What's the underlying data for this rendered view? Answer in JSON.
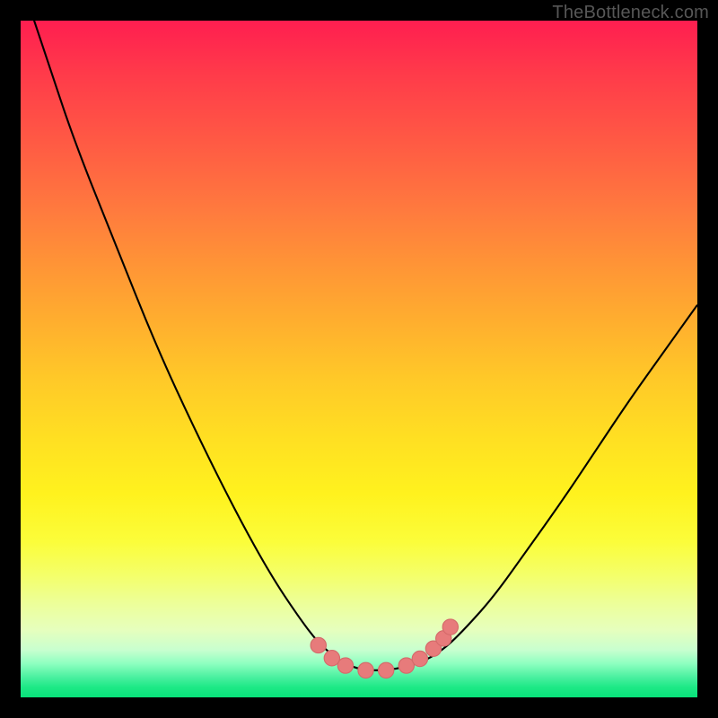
{
  "watermark": "TheBottleneck.com",
  "colors": {
    "frame": "#000000",
    "curve_stroke": "#000000",
    "marker_fill": "#e77b7b",
    "marker_stroke": "#d46a6a"
  },
  "chart_data": {
    "type": "line",
    "title": "",
    "xlabel": "",
    "ylabel": "",
    "xlim": [
      0,
      100
    ],
    "ylim": [
      0,
      100
    ],
    "grid": false,
    "legend": false,
    "note": "Axes have no numeric tick labels in the image; x/y are normalized 0–100 estimated from pixel positions. y is percent-from-top (0 = top edge, 100 = bottom edge).",
    "series": [
      {
        "name": "curve",
        "x": [
          0,
          4,
          8,
          14,
          20,
          26,
          32,
          37,
          41,
          44,
          47,
          49,
          51,
          54,
          57,
          60,
          63,
          66,
          70,
          75,
          80,
          85,
          90,
          95,
          100
        ],
        "y": [
          -6,
          6,
          18,
          33,
          48,
          61,
          73,
          82,
          88,
          92,
          94.5,
          95.5,
          96,
          96,
          95.5,
          94.5,
          92.5,
          89.5,
          85,
          78,
          71,
          63.5,
          56,
          49,
          42
        ]
      }
    ],
    "markers": {
      "name": "highlight-points",
      "x": [
        44,
        46,
        48,
        51,
        54,
        57,
        59,
        61,
        62.5,
        63.5
      ],
      "y": [
        92.3,
        94.2,
        95.3,
        96.0,
        96.0,
        95.3,
        94.3,
        92.8,
        91.3,
        89.6
      ]
    }
  }
}
